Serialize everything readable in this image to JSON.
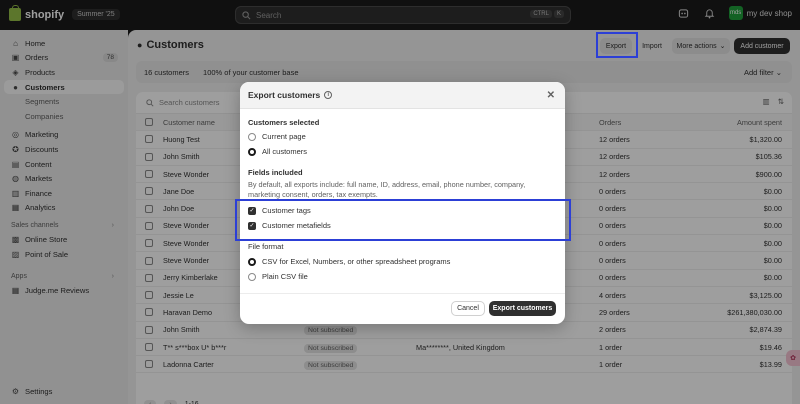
{
  "topbar": {
    "brand": "shopify",
    "edition": "Summer '25",
    "search_placeholder": "Search",
    "shortcut_keys": [
      "CTRL",
      "K"
    ],
    "shop_initials": "mds",
    "shop_name": "my dev shop"
  },
  "sidebar": {
    "items": [
      {
        "label": "Home",
        "icon": "home-icon"
      },
      {
        "label": "Orders",
        "icon": "orders-icon",
        "count": "78"
      },
      {
        "label": "Products",
        "icon": "tag-icon"
      },
      {
        "label": "Customers",
        "icon": "person-icon",
        "active": true
      },
      {
        "label": "Segments",
        "sub": true
      },
      {
        "label": "Companies",
        "sub": true
      },
      {
        "label": "Marketing",
        "icon": "target-icon"
      },
      {
        "label": "Discounts",
        "icon": "discount-icon"
      },
      {
        "label": "Content",
        "icon": "content-icon"
      },
      {
        "label": "Markets",
        "icon": "globe-icon"
      },
      {
        "label": "Finance",
        "icon": "bank-icon"
      },
      {
        "label": "Analytics",
        "icon": "chart-icon"
      }
    ],
    "sales_channels_label": "Sales channels",
    "sales_channels": [
      {
        "label": "Online Store",
        "icon": "store-icon"
      },
      {
        "label": "Point of Sale",
        "icon": "pos-icon"
      }
    ],
    "apps_label": "Apps",
    "apps": [
      {
        "label": "Judge.me Reviews",
        "icon": "app-grid-icon"
      }
    ],
    "settings_label": "Settings"
  },
  "page": {
    "title": "Customers",
    "buttons": {
      "export": "Export",
      "import": "Import",
      "more_actions": "More actions",
      "add_customer": "Add customer"
    },
    "stats": {
      "count": "16 customers",
      "base": "100% of your customer base",
      "add_filter": "Add filter"
    },
    "search_placeholder": "Search customers",
    "columns": {
      "name": "Customer name",
      "orders": "Orders",
      "amount": "Amount spent"
    },
    "rows": [
      {
        "name": "Huong Test",
        "status": "",
        "location": "",
        "orders": "12 orders",
        "amount": "$1,320.00"
      },
      {
        "name": "John Smith",
        "status": "",
        "location": "",
        "orders": "12 orders",
        "amount": "$105.36"
      },
      {
        "name": "Steve Wonder",
        "status": "",
        "location": "",
        "orders": "12 orders",
        "amount": "$900.00"
      },
      {
        "name": "Jane Doe",
        "status": "",
        "location": "",
        "orders": "0 orders",
        "amount": "$0.00"
      },
      {
        "name": "John Doe",
        "status": "",
        "location": "",
        "orders": "0 orders",
        "amount": "$0.00"
      },
      {
        "name": "Steve Wonder",
        "status": "",
        "location": "",
        "orders": "0 orders",
        "amount": "$0.00"
      },
      {
        "name": "Steve Wonder",
        "status": "",
        "location": "",
        "orders": "0 orders",
        "amount": "$0.00"
      },
      {
        "name": "Steve Wonder",
        "status": "",
        "location": "",
        "orders": "0 orders",
        "amount": "$0.00"
      },
      {
        "name": "Jerry Kimberlake",
        "status": "",
        "location": "",
        "orders": "0 orders",
        "amount": "$0.00"
      },
      {
        "name": "Jessie Le",
        "status": "",
        "location": "",
        "orders": "4 orders",
        "amount": "$3,125.00"
      },
      {
        "name": "Haravan Demo",
        "status": "",
        "location": "",
        "orders": "29 orders",
        "amount": "$261,380,030.00"
      },
      {
        "name": "John Smith",
        "status": "Not subscribed",
        "location": "",
        "orders": "2 orders",
        "amount": "$2,874.39"
      },
      {
        "name": "T** s***box U* b***r",
        "status": "Not subscribed",
        "location": "Ma********, United Kingdom",
        "orders": "1 order",
        "amount": "$19.46"
      },
      {
        "name": "Ladonna Carter",
        "status": "Not subscribed",
        "location": "",
        "orders": "1 order",
        "amount": "$13.99"
      }
    ],
    "pagination": "1-16"
  },
  "modal": {
    "title": "Export customers",
    "customers_selected_label": "Customers selected",
    "selection_options": [
      {
        "label": "Current page",
        "selected": false
      },
      {
        "label": "All customers",
        "selected": true
      }
    ],
    "fields_label": "Fields included",
    "fields_desc": "By default, all exports include: full name, ID, address, email, phone number, company, marketing consent, orders, tax exempts.",
    "field_options": [
      {
        "label": "Customer tags",
        "checked": true
      },
      {
        "label": "Customer metafields",
        "checked": true
      }
    ],
    "format_label": "File format",
    "format_options": [
      {
        "label": "CSV for Excel, Numbers, or other spreadsheet programs",
        "selected": true
      },
      {
        "label": "Plain CSV file",
        "selected": false
      }
    ],
    "cancel": "Cancel",
    "submit": "Export customers"
  },
  "colors": {
    "highlight": "#2c3fd6",
    "primary_button": "#303030",
    "brand_green": "#95bf47"
  }
}
